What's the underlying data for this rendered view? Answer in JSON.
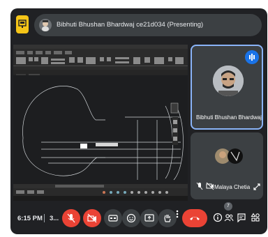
{
  "top_bar": {
    "presenter_label": "Bibhuti Bhushan Bhardwaj ce21d034 (Presenting)"
  },
  "tiles": [
    {
      "name": "Bibhuti Bhushan Bhardwaj ..."
    },
    {
      "name": "Malaya Chetia"
    }
  ],
  "bottom_bar": {
    "time": "6:15 PM",
    "meeting_code": "3...",
    "people_count": "7"
  },
  "colors": {
    "background": "#202124",
    "tile": "#3c4043",
    "active_border": "#8ab4f8",
    "danger": "#ea4335",
    "accent": "#1a73e8",
    "present_badge": "#f5c518"
  },
  "icons": {
    "top_badge": "present-icon",
    "controls": [
      "mic-off-icon",
      "cam-off-icon",
      "captions-icon",
      "emoji-icon",
      "present-screen-icon",
      "raise-hand-icon",
      "more-options-icon",
      "end-call-icon"
    ],
    "right": [
      "info-icon",
      "people-icon",
      "chat-icon",
      "activities-icon"
    ]
  }
}
